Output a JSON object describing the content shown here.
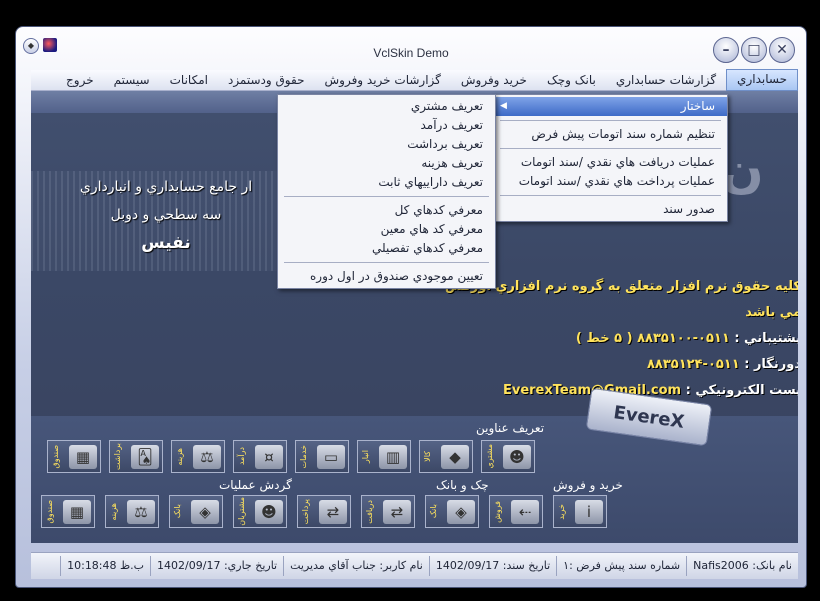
{
  "window": {
    "title": "VclSkin Demo"
  },
  "menubar": [
    {
      "label": "حسابداري",
      "active": true
    },
    {
      "label": "گزارشات حسابداري"
    },
    {
      "label": "بانک وچک"
    },
    {
      "label": "خريد وفروش"
    },
    {
      "label": "گزارشات خريد وفروش"
    },
    {
      "label": "حقوق ودستمزد"
    },
    {
      "label": "امکانات"
    },
    {
      "label": "سيستم"
    },
    {
      "label": "خروج"
    }
  ],
  "submenu_accounting": [
    {
      "label": "ساختار",
      "hl": true
    },
    {
      "sep": true
    },
    {
      "label": "تنظيم شماره سند اتومات پيش فرض"
    },
    {
      "sep": true
    },
    {
      "label": "عمليات دريافت هاي نقدي /سند اتومات"
    },
    {
      "label": "عمليات پرداخت هاي نقدي /سند اتومات"
    },
    {
      "sep": true
    },
    {
      "label": "صدور سند"
    }
  ],
  "submenu_structure": [
    {
      "label": "تعريف مشتري"
    },
    {
      "label": "تعريف درآمد"
    },
    {
      "label": "تعريف برداشت"
    },
    {
      "label": "تعريف هزينه"
    },
    {
      "label": "تعريف داراييهاي ثابت"
    },
    {
      "sep": true
    },
    {
      "label": "معرفي کدهاي کل"
    },
    {
      "label": "معرفي کد هاي معين"
    },
    {
      "label": "معرفي کدهاي تفصيلي"
    },
    {
      "sep": true
    },
    {
      "label": "تعيين موجودي صندوق در اول دوره"
    }
  ],
  "splash": {
    "line1": "ار جامع حسابداري و انبارداري",
    "line2": "سه سطحي و دوبل",
    "line3": "نفيس",
    "logo_letter": "ن",
    "copyright": "کليه حقوق نرم افزار متعلق به گروه نرم افزاري اورکس مي باشد",
    "support_label": "پشتيباني :",
    "support_value": "۰۵۱۱-۸۸۳۵۱۰۰ ( ۵ خط )",
    "fax_label": "دورنگار :",
    "fax_value": "۰۵۱۱-۸۸۳۵۱۲۴",
    "email_label": "پست الکترونيکي :",
    "email_value": "EverexTeam@Gmail.com",
    "brand": "EvereX"
  },
  "groups": {
    "definitions": "تعريف عناوين",
    "operations": "گردش عمليات",
    "cheque_bank": "چک و بانک",
    "buy_sell": "خريد و فروش"
  },
  "row1_buttons": [
    {
      "label": "صندوق",
      "icon": "safe-icon",
      "glyph": "▦"
    },
    {
      "label": "برداشت",
      "icon": "cards-icon",
      "glyph": "🂡"
    },
    {
      "label": "هزينه",
      "icon": "scale-icon",
      "glyph": "⚖"
    },
    {
      "label": "درآمد",
      "icon": "money-icon",
      "glyph": "¤"
    },
    {
      "label": "خدمات",
      "icon": "scanner-icon",
      "glyph": "▭"
    },
    {
      "label": "انبار",
      "icon": "warehouse-icon",
      "glyph": "▥"
    },
    {
      "label": "کالا",
      "icon": "goods-icon",
      "glyph": "◆"
    },
    {
      "label": "مشتري",
      "icon": "customer-icon",
      "glyph": "☻"
    }
  ],
  "row2_buttons": [
    {
      "label": "صندوق",
      "icon": "safe-icon",
      "glyph": "▦"
    },
    {
      "label": "هزينه",
      "icon": "scale-icon",
      "glyph": "⚖"
    },
    {
      "label": "بانک",
      "icon": "bank-icon",
      "glyph": "◈"
    },
    {
      "label": "مشتريان",
      "icon": "customer-icon",
      "glyph": "☻"
    },
    {
      "label": "پرداخت",
      "icon": "pay-icon",
      "glyph": "⇄"
    },
    {
      "label": "دريافت",
      "icon": "receive-icon",
      "glyph": "⇄"
    },
    {
      "label": "بانک",
      "icon": "bank-icon",
      "glyph": "◈"
    },
    {
      "label": "فروش",
      "icon": "sell-icon",
      "glyph": "⇠"
    },
    {
      "label": "خريد",
      "icon": "buy-icon",
      "glyph": "i"
    }
  ],
  "status": [
    "نام بانک: Nafis2006",
    "شماره سند پيش فرض :۱",
    "تاريخ سند: 1402/09/17",
    "نام کاربر: جناب آقاي مديريت",
    "تاريخ جاري: 1402/09/17",
    "ب.ظ 10:18:48"
  ]
}
